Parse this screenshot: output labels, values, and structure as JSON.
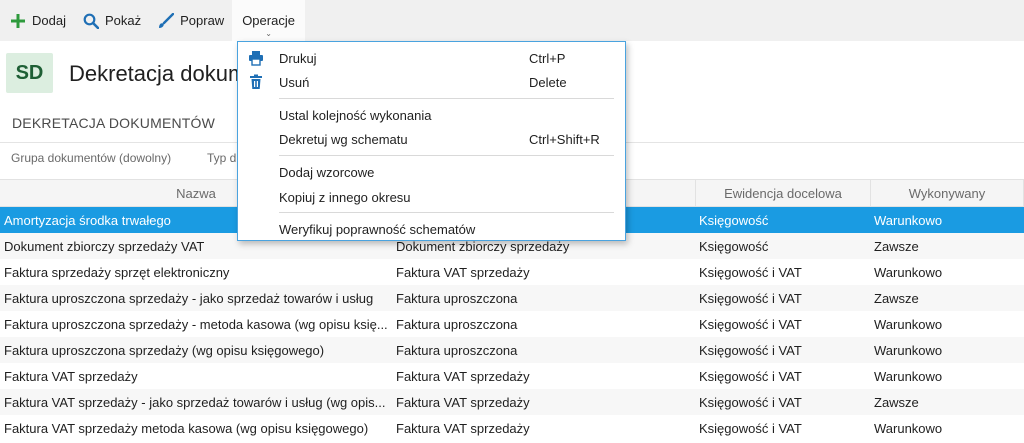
{
  "toolbar": {
    "add_label": "Dodaj",
    "show_label": "Pokaż",
    "edit_label": "Popraw",
    "operations_label": "Operacje"
  },
  "header": {
    "badge": "SD",
    "title": "Dekretacja dokum"
  },
  "section": {
    "title": "DEKRETACJA DOKUMENTÓW"
  },
  "filters": {
    "group": "Grupa dokumentów (dowolny)",
    "type": "Typ d"
  },
  "grid": {
    "columns": [
      "Nazwa",
      "",
      "Ewidencja docelowa",
      "Wykonywany"
    ],
    "rows": [
      [
        "Amortyzacja środka trwałego",
        "",
        "Księgowość",
        "Warunkowo"
      ],
      [
        "Dokument zbiorczy sprzedaży VAT",
        "Dokument zbiorczy sprzedaży",
        "Księgowość",
        "Zawsze"
      ],
      [
        "Faktura sprzedaży sprzęt elektroniczny",
        "Faktura VAT sprzedaży",
        "Księgowość i VAT",
        "Warunkowo"
      ],
      [
        "Faktura uproszczona sprzedaży - jako sprzedaż towarów i usług",
        "Faktura uproszczona",
        "Księgowość i VAT",
        "Zawsze"
      ],
      [
        "Faktura uproszczona sprzedaży - metoda kasowa (wg opisu księ...",
        "Faktura uproszczona",
        "Księgowość i VAT",
        "Warunkowo"
      ],
      [
        "Faktura uproszczona sprzedaży (wg opisu księgowego)",
        "Faktura uproszczona",
        "Księgowość i VAT",
        "Warunkowo"
      ],
      [
        "Faktura VAT sprzedaży",
        "Faktura VAT sprzedaży",
        "Księgowość i VAT",
        "Warunkowo"
      ],
      [
        "Faktura VAT sprzedaży - jako sprzedaż towarów i usług (wg opis...",
        "Faktura VAT sprzedaży",
        "Księgowość i VAT",
        "Zawsze"
      ],
      [
        "Faktura VAT sprzedaży metoda kasowa (wg opisu księgowego)",
        "Faktura VAT sprzedaży",
        "Księgowość i VAT",
        "Warunkowo"
      ]
    ]
  },
  "menu": {
    "items": [
      {
        "label": "Drukuj",
        "shortcut": "Ctrl+P",
        "icon": "printer-icon"
      },
      {
        "label": "Usuń",
        "shortcut": "Delete",
        "icon": "trash-icon"
      },
      {
        "label": "Ustal kolejność wykonania",
        "shortcut": ""
      },
      {
        "label": "Dekretuj wg schematu",
        "shortcut": "Ctrl+Shift+R"
      },
      {
        "label": "Dodaj wzorcowe",
        "shortcut": ""
      },
      {
        "label": "Kopiuj z innego okresu",
        "shortcut": ""
      },
      {
        "label": "Weryfikuj poprawność schematów",
        "shortcut": ""
      }
    ]
  },
  "colors": {
    "accent": "#1a9be2",
    "icon_blue": "#1f6fb5",
    "add_green": "#2e9a3d",
    "badge_bg": "#dceee0"
  }
}
